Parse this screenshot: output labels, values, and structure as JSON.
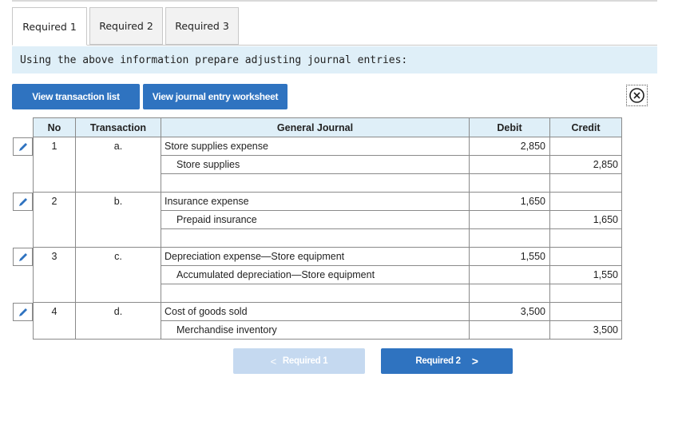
{
  "tabs": [
    "Required 1",
    "Required 2",
    "Required 3"
  ],
  "instruction": "Using the above information prepare adjusting journal entries:",
  "buttons": {
    "view_transactions": "View transaction list",
    "view_worksheet": "View journal entry worksheet"
  },
  "table": {
    "headers": {
      "no": "No",
      "transaction": "Transaction",
      "general_journal": "General Journal",
      "debit": "Debit",
      "credit": "Credit"
    },
    "entries": [
      {
        "no": "1",
        "transaction": "a.",
        "debit_account": "Store supplies expense",
        "credit_account": "Store supplies",
        "debit": "2,850",
        "credit": "2,850"
      },
      {
        "no": "2",
        "transaction": "b.",
        "debit_account": "Insurance expense",
        "credit_account": "Prepaid insurance",
        "debit": "1,650",
        "credit": "1,650"
      },
      {
        "no": "3",
        "transaction": "c.",
        "debit_account": "Depreciation expense—Store equipment",
        "credit_account": "Accumulated depreciation—Store equipment",
        "debit": "1,550",
        "credit": "1,550"
      },
      {
        "no": "4",
        "transaction": "d.",
        "debit_account": "Cost of goods sold",
        "credit_account": "Merchandise inventory",
        "debit": "3,500",
        "credit": "3,500"
      }
    ]
  },
  "nav": {
    "prev_label": "Required 1",
    "prev_arrow": "<",
    "next_label": "Required 2",
    "next_arrow": ">"
  },
  "colors": {
    "accent": "#2f73c0",
    "disabled": "#c5d9f0",
    "header_bg": "#dfeff8"
  }
}
